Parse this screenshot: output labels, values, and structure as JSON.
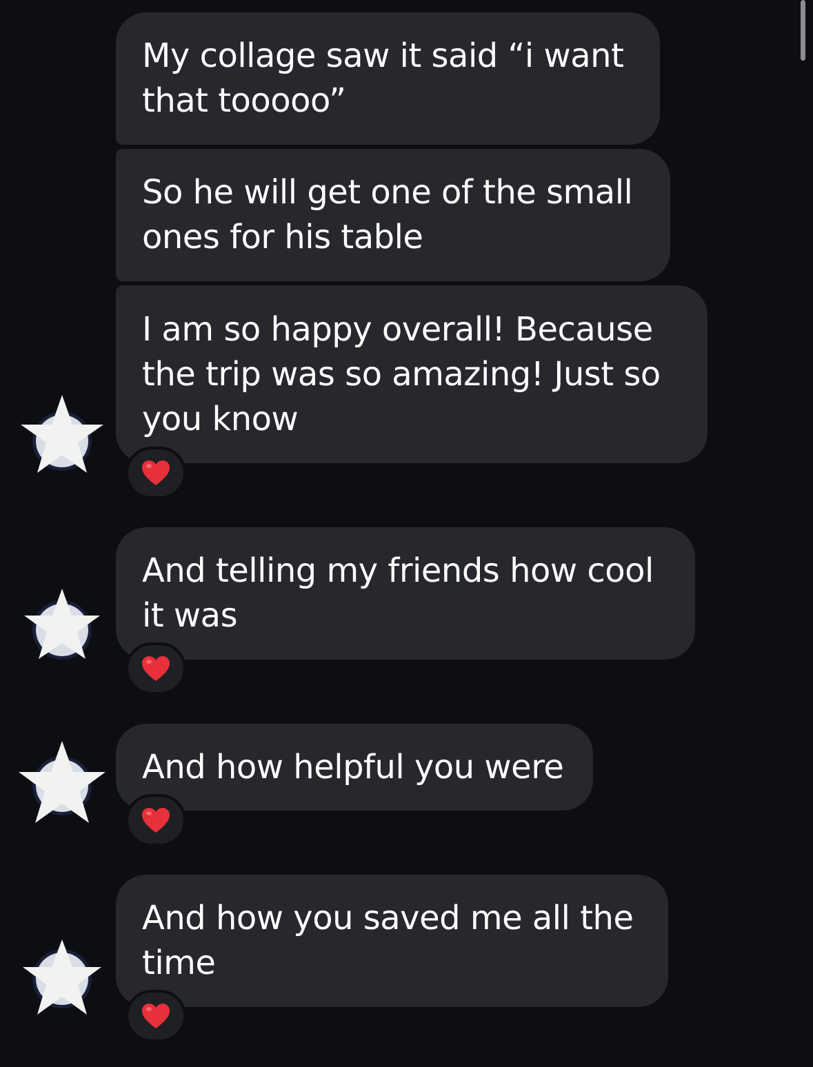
{
  "messages": [
    {
      "text": "My collage saw it said “i want that tooooo”",
      "reaction": null
    },
    {
      "text": "So he will get one of the small ones for his table",
      "reaction": null
    },
    {
      "text": "I am so happy overall! Because the trip was so amazing! Just so you know",
      "reaction": "heart"
    },
    {
      "text": "And telling my friends how cool it was",
      "reaction": "heart"
    },
    {
      "text": "And how helpful you were",
      "reaction": "heart"
    },
    {
      "text": "And how you saved me all the time",
      "reaction": "heart"
    }
  ],
  "colors": {
    "background": "#0c0e12",
    "bubble": "#26282d",
    "text": "#ffffff",
    "heart": "#e8303a",
    "avatar_star": "#f2f2f0"
  },
  "icons": {
    "reaction": "heart-icon",
    "avatar_overlay": "star-icon"
  }
}
